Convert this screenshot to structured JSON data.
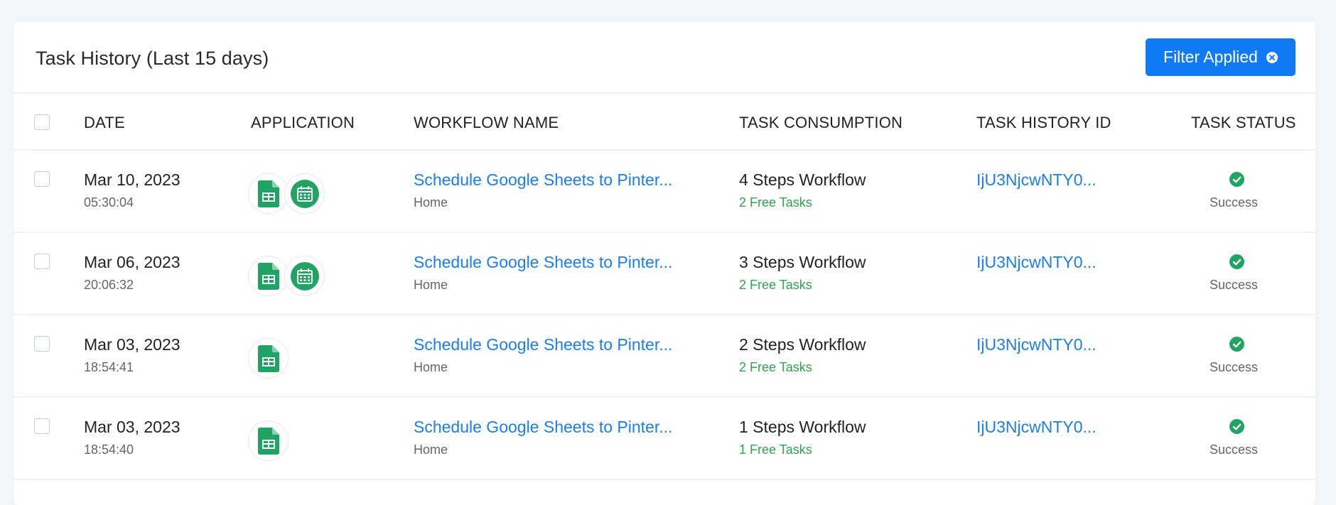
{
  "header": {
    "title": "Task History (Last 15 days)",
    "filter_button_label": "Filter Applied"
  },
  "columns": {
    "date": "DATE",
    "application": "APPLICATION",
    "workflow_name": "WORKFLOW NAME",
    "task_consumption": "TASK CONSUMPTION",
    "task_history_id": "TASK HISTORY ID",
    "task_status": "TASK STATUS"
  },
  "rows": [
    {
      "date": "Mar 10, 2023",
      "time": "05:30:04",
      "apps": [
        "google-sheets-icon",
        "schedule-calendar-icon"
      ],
      "workflow": "Schedule Google Sheets to Pinter...",
      "folder": "Home",
      "steps": "4 Steps Workflow",
      "tasks": "2 Free Tasks",
      "history_id": "IjU3NjcwNTY0...",
      "status": "Success"
    },
    {
      "date": "Mar 06, 2023",
      "time": "20:06:32",
      "apps": [
        "google-sheets-icon",
        "schedule-calendar-icon"
      ],
      "workflow": "Schedule Google Sheets to Pinter...",
      "folder": "Home",
      "steps": "3 Steps Workflow",
      "tasks": "2 Free Tasks",
      "history_id": "IjU3NjcwNTY0...",
      "status": "Success"
    },
    {
      "date": "Mar 03, 2023",
      "time": "18:54:41",
      "apps": [
        "google-sheets-icon"
      ],
      "workflow": "Schedule Google Sheets to Pinter...",
      "folder": "Home",
      "steps": "2 Steps Workflow",
      "tasks": "2 Free Tasks",
      "history_id": "IjU3NjcwNTY0...",
      "status": "Success"
    },
    {
      "date": "Mar 03, 2023",
      "time": "18:54:40",
      "apps": [
        "google-sheets-icon"
      ],
      "workflow": "Schedule Google Sheets to Pinter...",
      "folder": "Home",
      "steps": "1 Steps Workflow",
      "tasks": "1 Free Tasks",
      "history_id": "IjU3NjcwNTY0...",
      "status": "Success"
    }
  ],
  "colors": {
    "accent": "#1079f4",
    "link": "#1a7ef2",
    "success": "#2ea44f",
    "app_green": "#20a464"
  }
}
